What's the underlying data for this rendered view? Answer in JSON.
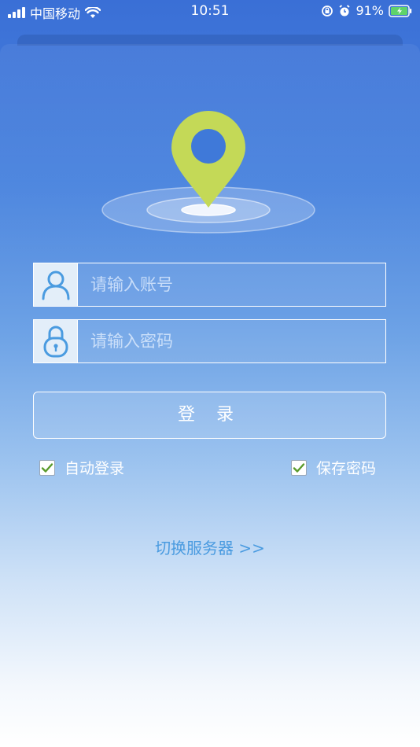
{
  "status_bar": {
    "carrier": "中国移动",
    "time": "10:51",
    "battery": "91%"
  },
  "login": {
    "account_placeholder": "请输入账号",
    "password_placeholder": "请输入密码",
    "login_label": "登 录",
    "auto_login_label": "自动登录",
    "save_password_label": "保存密码",
    "switch_server_label": "切换服务器 >>"
  },
  "colors": {
    "accent_green": "#c4d957",
    "link_blue": "#4a9be0",
    "icon_blue": "#4a9be0"
  },
  "icons": [
    "signal-icon",
    "wifi-icon",
    "orientation-lock-icon",
    "alarm-icon",
    "battery-icon",
    "location-pin-icon",
    "user-icon",
    "lock-icon",
    "checkmark-icon"
  ]
}
